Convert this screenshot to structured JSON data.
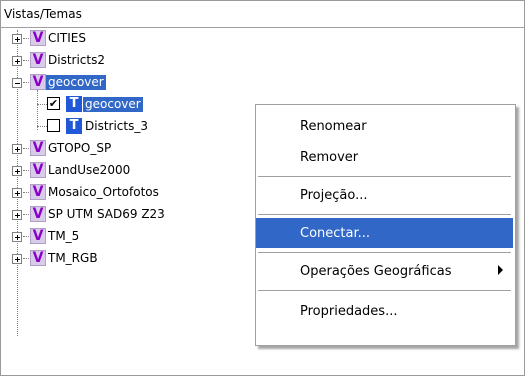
{
  "header": {
    "title": "Vistas/Temas"
  },
  "tree": {
    "nodes": [
      {
        "label": "CITIES",
        "icon": "V"
      },
      {
        "label": "Districts2",
        "icon": "V"
      },
      {
        "label": "geocover",
        "icon": "V",
        "expanded": true,
        "selected": true,
        "children": [
          {
            "label": "geocover",
            "icon": "T",
            "checked": true,
            "selected": true
          },
          {
            "label": "Districts_3",
            "icon": "T",
            "checked": false
          }
        ]
      },
      {
        "label": "GTOPO_SP",
        "icon": "V"
      },
      {
        "label": "LandUse2000",
        "icon": "V"
      },
      {
        "label": "Mosaico_Ortofotos",
        "icon": "V"
      },
      {
        "label": "SP UTM SAD69 Z23",
        "icon": "V"
      },
      {
        "label": "TM_5",
        "icon": "V"
      },
      {
        "label": "TM_RGB",
        "icon": "V"
      }
    ]
  },
  "context_menu": {
    "items": [
      {
        "label": "Renomear"
      },
      {
        "label": "Remover"
      },
      {
        "label": "Projeção..."
      },
      {
        "label": "Conectar...",
        "highlighted": true
      },
      {
        "label": "Operações Geográficas",
        "submenu": true
      },
      {
        "label": "Propriedades..."
      }
    ]
  },
  "colors": {
    "selection": "#3168c8",
    "view_icon": "#8b00c8",
    "theme_icon": "#2058d8"
  }
}
